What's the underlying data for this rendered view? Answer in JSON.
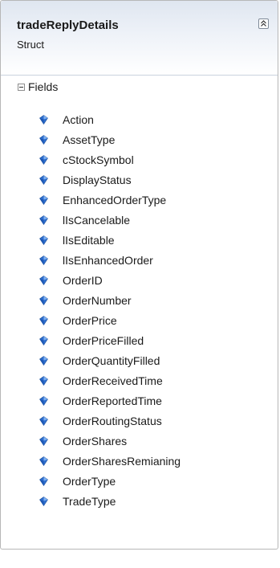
{
  "shape": {
    "title": "tradeReplyDetails",
    "kind": "Struct",
    "collapse_icon": "double-chevron-up-icon"
  },
  "section": {
    "label": "Fields",
    "expander_icon": "minus-box-icon"
  },
  "field_icon": "field-diamond-icon",
  "colors": {
    "header_top": "#dfe6f0",
    "field_icon": "#2f6fcf"
  },
  "fields": [
    "Action",
    "AssetType",
    "cStockSymbol",
    "DisplayStatus",
    "EnhancedOrderType",
    "lIsCancelable",
    "lIsEditable",
    "lIsEnhancedOrder",
    "OrderID",
    "OrderNumber",
    "OrderPrice",
    "OrderPriceFilled",
    "OrderQuantityFilled",
    "OrderReceivedTime",
    "OrderReportedTime",
    "OrderRoutingStatus",
    "OrderShares",
    "OrderSharesRemianing",
    "OrderType",
    "TradeType"
  ]
}
